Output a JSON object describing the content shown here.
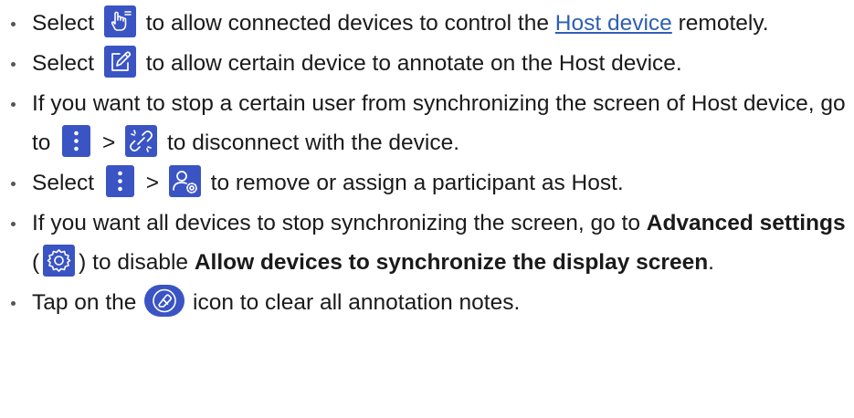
{
  "bullets": [
    {
      "pre": "Select ",
      "icon": "remote-control-icon",
      "mid": " to allow connected devices to control the ",
      "link": "Host device",
      "post": " remotely."
    },
    {
      "pre": "Select ",
      "icon": "annotate-icon",
      "post": " to allow certain device to annotate on the Host device."
    },
    {
      "pre": "If you want to stop a certain user from synchronizing the screen of Host device, go to ",
      "icon1": "more-options-icon",
      "sep": " > ",
      "icon2": "disconnect-link-icon",
      "post": " to disconnect with the device."
    },
    {
      "pre": "Select ",
      "icon1": "more-options-icon",
      "sep": " > ",
      "icon2": "participant-settings-icon",
      "post": " to remove or assign a participant as Host."
    },
    {
      "pre": "If you want all devices to stop synchronizing the screen, go to ",
      "bold1": "Advanced settings",
      "paren_open": " (",
      "icon": "gear-icon",
      "paren_close": ") to disable ",
      "bold2": "Allow devices to synchronize the display screen",
      "post": "."
    },
    {
      "pre": "Tap on the ",
      "icon": "eraser-icon",
      "post": " icon to clear all annotation notes."
    }
  ],
  "colors": {
    "icon_background": "#3a54c4",
    "link": "#2f5fb3",
    "text": "#1a1a1a"
  }
}
